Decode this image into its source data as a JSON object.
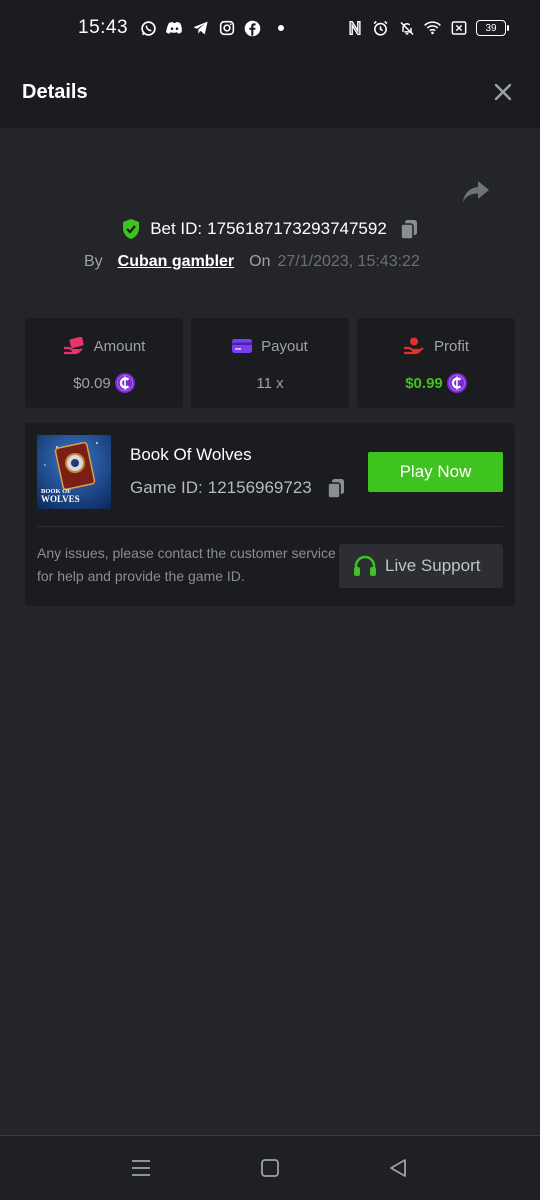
{
  "status_bar": {
    "time": "15:43",
    "left_icons": [
      "whatsapp-icon",
      "discord-icon",
      "telegram-icon",
      "instagram-icon",
      "facebook-icon"
    ],
    "right_icons": [
      "nfc-icon",
      "alarm-icon",
      "bell-off-icon",
      "wifi-icon",
      "x-icon"
    ],
    "battery": "39"
  },
  "header": {
    "title": "Details"
  },
  "bet": {
    "label": "Bet ID:",
    "id": "1756187173293747592",
    "by_label": "By",
    "user": "Cuban gambler",
    "on_label": "On",
    "date": "27/1/2023, 15:43:22"
  },
  "stats": [
    {
      "label": "Amount",
      "value": "$0.09",
      "icon": "hand-money-icon",
      "color": "#e8336b"
    },
    {
      "label": "Payout",
      "value": "11 x",
      "icon": "card-icon",
      "color": "#7a3df0"
    },
    {
      "label": "Profit",
      "value": "$0.99",
      "icon": "hand-coins-icon",
      "color": "#e0302f",
      "value_color": "#3fc31f"
    }
  ],
  "game": {
    "name": "Book Of Wolves",
    "id_label": "Game ID:",
    "id": "12156969723",
    "thumb_text": "BOOK OF WOLVES",
    "play_label": "Play Now",
    "issue_text": "Any issues, please contact the customer service for help and provide the game ID.",
    "support_label": "Live Support"
  },
  "colors": {
    "accent_green": "#3fc31f",
    "coin_purple": "#7a28cf",
    "bg": "#242529",
    "panel": "#1b1c1f"
  },
  "nav": [
    "menu-icon",
    "home-icon",
    "back-icon"
  ]
}
